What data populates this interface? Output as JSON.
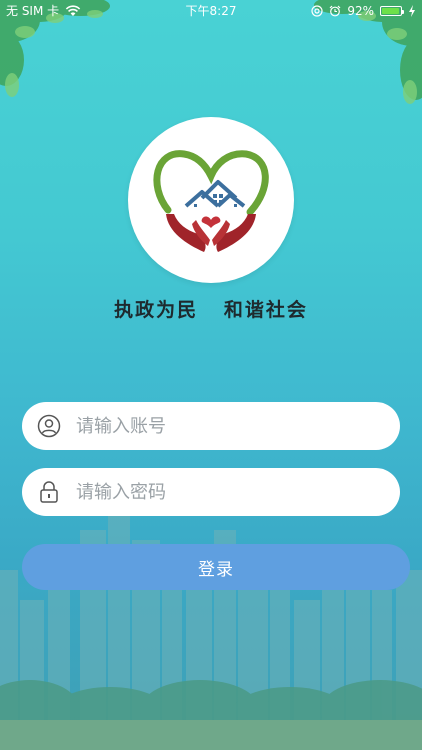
{
  "status_bar": {
    "carrier": "无 SIM 卡",
    "time": "下午8:27",
    "battery_percent": "92%",
    "battery_level": 0.92
  },
  "logo": {
    "slogan": "执政为民   和谐社会"
  },
  "login_form": {
    "account_placeholder": "请输入账号",
    "password_placeholder": "请输入密码",
    "login_label": "登录"
  },
  "icons": [
    "wifi-icon",
    "at-icon",
    "alarm-icon",
    "battery-icon",
    "charging-icon",
    "user-icon",
    "lock-icon"
  ],
  "colors": {
    "background_top": "#49d2d4",
    "background_bottom": "#3f9fb4",
    "button": "#5f9fe0",
    "heart_green": "#6aa436",
    "hands_red": "#a0242a",
    "roof_blue": "#3c6f9e"
  }
}
